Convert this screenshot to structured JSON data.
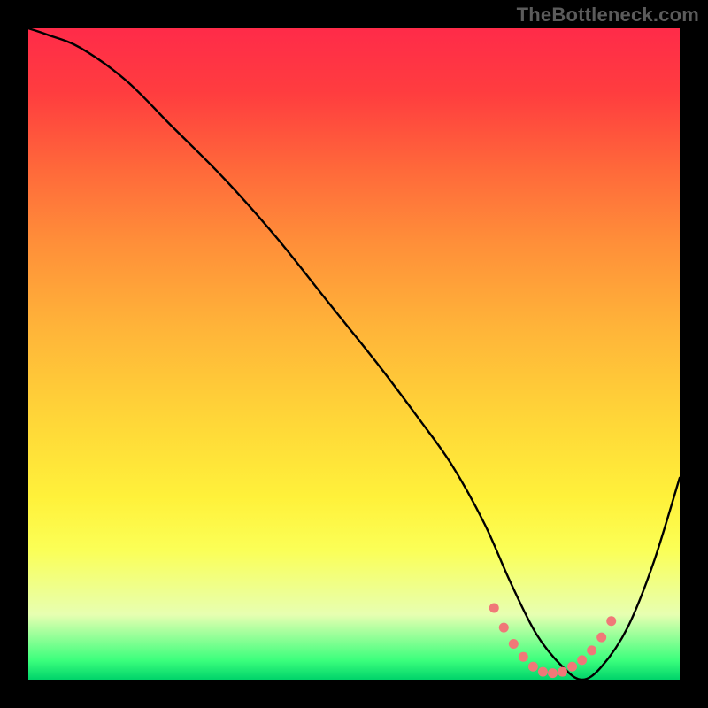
{
  "watermark": "TheBottleneck.com",
  "colors": {
    "background": "#000000",
    "gradient_top": "#ff2b49",
    "gradient_mid": "#ffd638",
    "gradient_bottom": "#00d36a",
    "curve": "#000000",
    "marker": "#f07878"
  },
  "chart_data": {
    "type": "line",
    "title": "",
    "xlabel": "",
    "ylabel": "",
    "xlim": [
      0,
      100
    ],
    "ylim": [
      0,
      100
    ],
    "grid": false,
    "legend": false,
    "series": [
      {
        "name": "curve",
        "x": [
          0,
          3,
          8,
          15,
          22,
          30,
          38,
          46,
          54,
          60,
          65,
          70,
          74,
          78,
          82,
          85,
          88,
          92,
          96,
          100
        ],
        "y": [
          100,
          99,
          97,
          92,
          85,
          77,
          68,
          58,
          48,
          40,
          33,
          24,
          15,
          7,
          2,
          0,
          2,
          8,
          18,
          31
        ]
      }
    ],
    "markers": {
      "name": "bottom-cluster",
      "x": [
        71.5,
        73,
        74.5,
        76,
        77.5,
        79,
        80.5,
        82,
        83.5,
        85,
        86.5,
        88,
        89.5
      ],
      "y": [
        11,
        8,
        5.5,
        3.5,
        2,
        1.2,
        1,
        1.2,
        2,
        3,
        4.5,
        6.5,
        9
      ]
    }
  }
}
